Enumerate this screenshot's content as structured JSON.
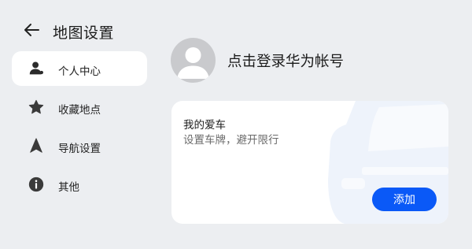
{
  "header": {
    "title": "地图设置",
    "back_icon": "arrow-left-icon"
  },
  "sidebar": {
    "items": [
      {
        "label": "个人中心",
        "icon": "person-icon",
        "active": true
      },
      {
        "label": "收藏地点",
        "icon": "star-icon",
        "active": false
      },
      {
        "label": "导航设置",
        "icon": "navigation-arrow-icon",
        "active": false
      },
      {
        "label": "其他",
        "icon": "info-icon",
        "active": false
      }
    ]
  },
  "profile": {
    "login_text": "点击登录华为帐号",
    "avatar_icon": "default-avatar-icon"
  },
  "car_card": {
    "title": "我的爱车",
    "subtitle": "设置车牌，避开限行",
    "add_button_label": "添加"
  },
  "colors": {
    "background": "#eceef1",
    "accent": "#0a59f7",
    "card": "#ffffff"
  }
}
